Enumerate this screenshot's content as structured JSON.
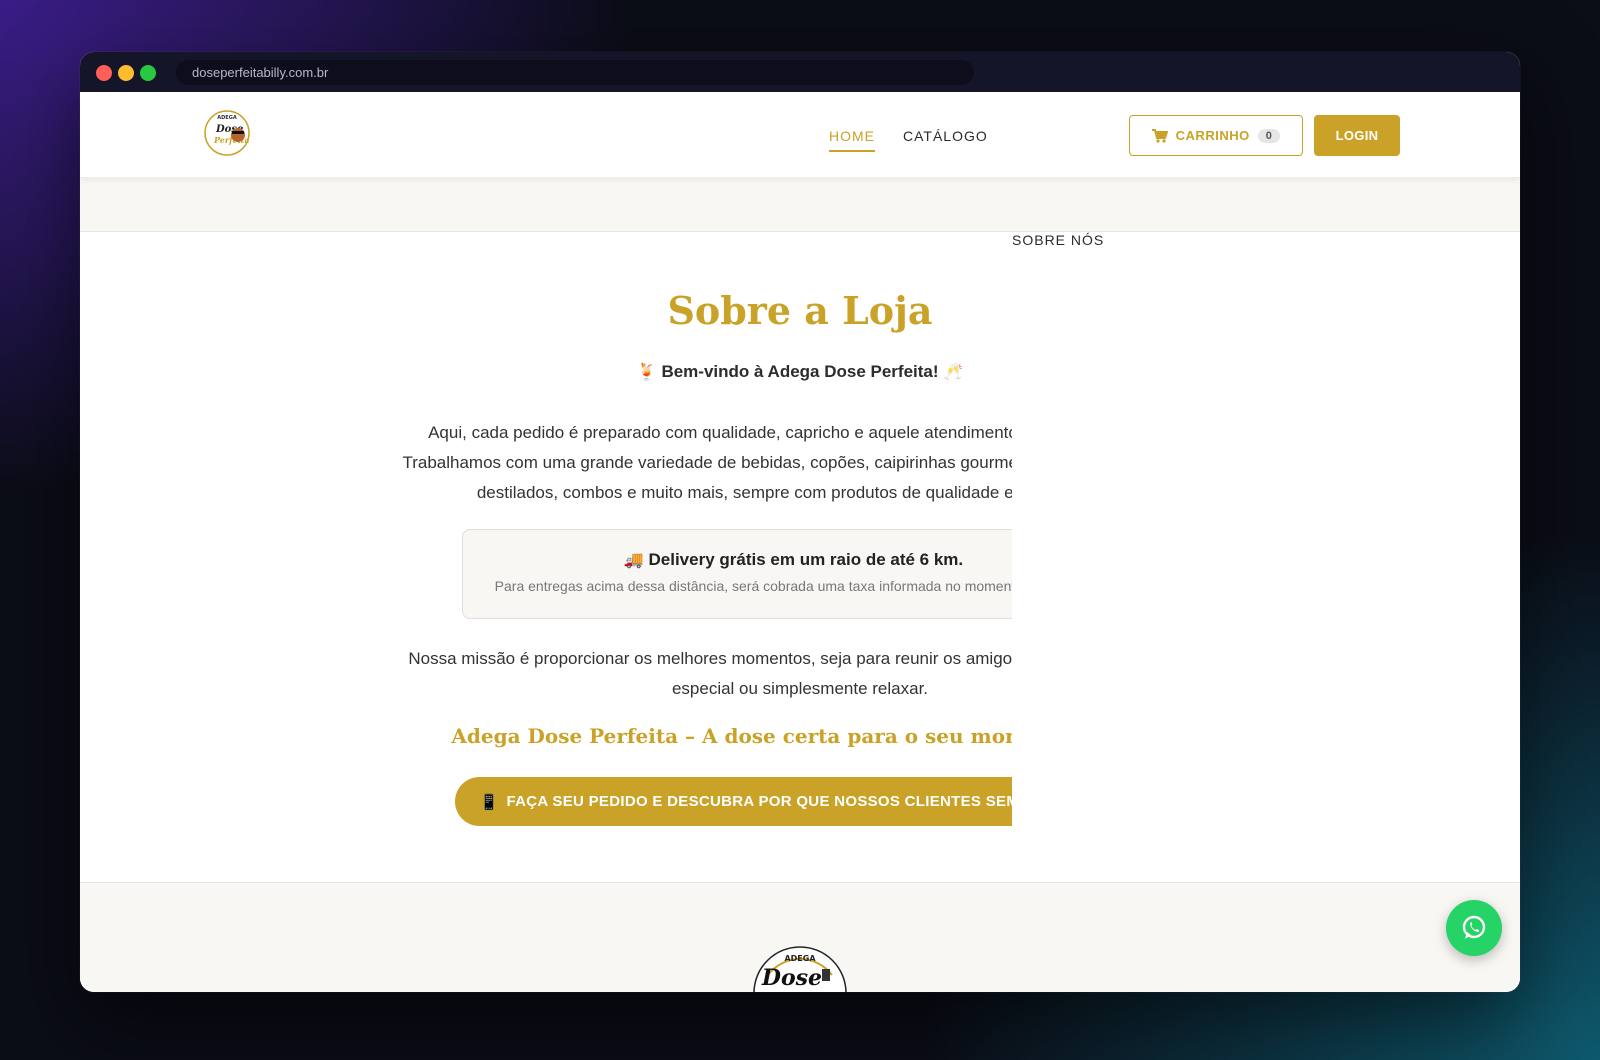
{
  "browser": {
    "url": "doseperfeitabilly.com.br"
  },
  "nav": {
    "links": [
      "HOME",
      "CATÁLOGO",
      "SOBRE NÓS"
    ],
    "cart_label": "CARRINHO",
    "cart_count": "0",
    "login_label": "LOGIN"
  },
  "about": {
    "title": "Sobre a Loja",
    "welcome_emoji_left": "🍹",
    "welcome": "Bem-vindo à Adega Dose Perfeita!",
    "welcome_emoji_right": "🥂",
    "paragraph1": "Aqui, cada pedido é preparado com qualidade, capricho e aquele atendimento que faz a diferença. Trabalhamos com uma grande variedade de bebidas, copões, caipirinhas gourmet, energéticos, cervejas, destilados, combos e muito mais, sempre com produtos de qualidade e preços justos.",
    "delivery_emoji": "🚚",
    "delivery_title": "Delivery grátis em um raio de até 6 km.",
    "delivery_sub": "Para entregas acima dessa distância, será cobrada uma taxa informada no momento do pedido.",
    "paragraph2": "Nossa missão é proporcionar os melhores momentos, seja para reunir os amigos, comemorar uma data especial ou simplesmente relaxar.",
    "slogan": "Adega Dose Perfeita – A dose certa para o seu momento!",
    "slogan_emojis": "🍾 🌅",
    "cta_emoji": "📱",
    "cta": "FAÇA SEU PEDIDO E DESCUBRA POR QUE NOSSOS CLIENTES SEMPRE VOLTAM!"
  },
  "logo": {
    "small_text": "ADEGA",
    "brand": "Dose Perfeita"
  },
  "footer_logo": {
    "top_text": "ADEGA",
    "brand": "Dose"
  },
  "colors": {
    "accent": "#c9a227",
    "whatsapp": "#25d366"
  },
  "icons": {
    "cart": "cart-icon",
    "whatsapp": "whatsapp-icon"
  }
}
